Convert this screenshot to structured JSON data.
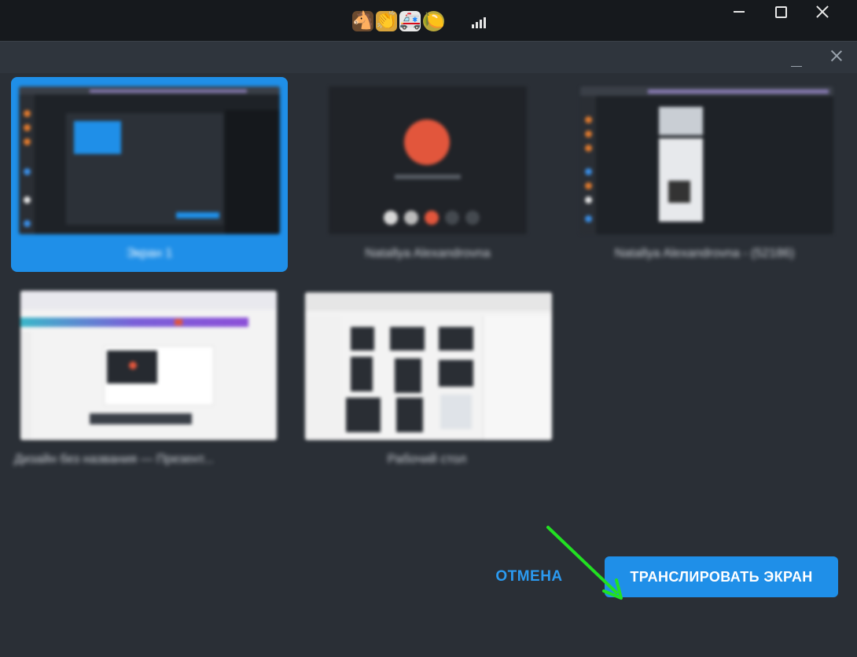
{
  "titlebar": {
    "emojis": [
      "🐴",
      "👏",
      "🚑",
      "🍋"
    ],
    "icons": [
      "horse-emoji-icon",
      "clapping-hands-emoji-icon",
      "ambulance-emoji-icon",
      "lemon-emoji-icon"
    ],
    "signal_icon": "signal-bars-icon"
  },
  "sources": [
    {
      "caption": "Экран 1",
      "selected": true
    },
    {
      "caption": "Natallya Alexandrovna",
      "selected": false
    },
    {
      "caption": "Natallya Alexandrovna - (52186)",
      "selected": false
    },
    {
      "caption": "Дизайн без названия — Презент...",
      "selected": false
    },
    {
      "caption": "Рабочий стол",
      "selected": false
    }
  ],
  "actions": {
    "cancel_label": "ОТМЕНА",
    "share_label": "ТРАНСЛИРОВАТЬ ЭКРАН"
  },
  "colors": {
    "accent": "#1f8fe8",
    "background": "#2a2f36",
    "arrow": "#22e022"
  }
}
